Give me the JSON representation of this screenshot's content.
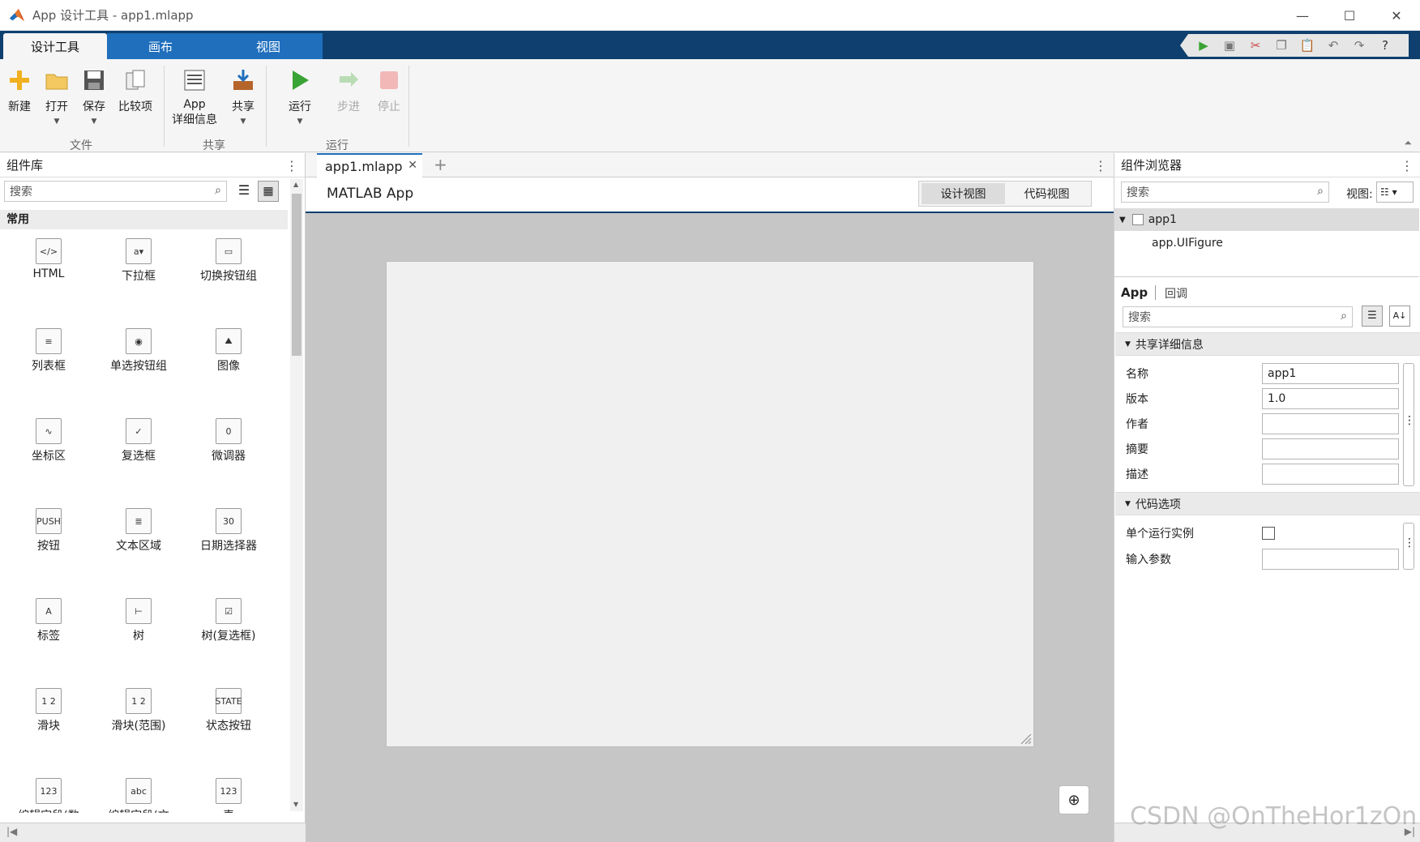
{
  "window": {
    "title": "App 设计工具 - app1.mlapp",
    "minimize": "—",
    "maximize": "☐",
    "close": "✕"
  },
  "tabs": [
    "设计工具",
    "画布",
    "视图"
  ],
  "quick_access": [
    "run-icon",
    "save-icon",
    "cut-icon",
    "copy-icon",
    "paste-icon",
    "undo-icon",
    "redo-icon",
    "help-icon"
  ],
  "toolstrip": {
    "file": {
      "label": "文件",
      "new": "新建",
      "open": "打开",
      "save": "保存",
      "compare": "比较项"
    },
    "share": {
      "label": "共享",
      "app_details_line1": "App",
      "app_details_line2": "详细信息",
      "share": "共享"
    },
    "run": {
      "label": "运行",
      "run": "运行",
      "step": "步进",
      "stop": "停止"
    }
  },
  "component_library": {
    "title": "组件库",
    "search_placeholder": "搜索",
    "section": "常用",
    "items": [
      {
        "label": "HTML",
        "icon": "html-icon",
        "glyph": "</>"
      },
      {
        "label": "下拉框",
        "icon": "dropdown-icon",
        "glyph": "a▾"
      },
      {
        "label": "切换按钮组",
        "icon": "toggle-button-group-icon",
        "glyph": "▭"
      },
      {
        "label": "列表框",
        "icon": "listbox-icon",
        "glyph": "≡"
      },
      {
        "label": "单选按钮组",
        "icon": "radio-button-group-icon",
        "glyph": "◉"
      },
      {
        "label": "图像",
        "icon": "image-icon",
        "glyph": "⛰"
      },
      {
        "label": "坐标区",
        "icon": "axes-icon",
        "glyph": "∿"
      },
      {
        "label": "复选框",
        "icon": "checkbox-icon",
        "glyph": "✓"
      },
      {
        "label": "微调器",
        "icon": "spinner-icon",
        "glyph": "0"
      },
      {
        "label": "按钮",
        "icon": "push-button-icon",
        "glyph": "PUSH"
      },
      {
        "label": "文本区域",
        "icon": "text-area-icon",
        "glyph": "≣"
      },
      {
        "label": "日期选择器",
        "icon": "date-picker-icon",
        "glyph": "30"
      },
      {
        "label": "标签",
        "icon": "label-icon",
        "glyph": "A"
      },
      {
        "label": "树",
        "icon": "tree-icon",
        "glyph": "⊢"
      },
      {
        "label": "树(复选框)",
        "icon": "checkbox-tree-icon",
        "glyph": "☑"
      },
      {
        "label": "滑块",
        "icon": "slider-icon",
        "glyph": "1 2"
      },
      {
        "label": "滑块(范围)",
        "icon": "range-slider-icon",
        "glyph": "1 2"
      },
      {
        "label": "状态按钮",
        "icon": "state-button-icon",
        "glyph": "STATE"
      },
      {
        "label": "编辑字段(数",
        "icon": "numeric-field-icon",
        "glyph": "123"
      },
      {
        "label": "编辑字段(文",
        "icon": "text-field-icon",
        "glyph": "abc"
      },
      {
        "label": "表",
        "icon": "table-icon",
        "glyph": "123"
      }
    ]
  },
  "editor": {
    "file_tab": "app1.mlapp",
    "app_name": "MATLAB App",
    "design_view": "设计视图",
    "code_view": "代码视图"
  },
  "component_browser": {
    "title": "组件浏览器",
    "search_placeholder": "搜索",
    "view_label": "视图:",
    "tree_root": "app1",
    "tree_child": "app.UIFigure",
    "tab_app": "App",
    "tab_callback": "回调",
    "prop_search_placeholder": "搜索",
    "section_shared": "共享详细信息",
    "section_code": "代码选项",
    "props": {
      "name_label": "名称",
      "name_value": "app1",
      "version_label": "版本",
      "version_value": "1.0",
      "author_label": "作者",
      "author_value": "",
      "summary_label": "摘要",
      "summary_value": "",
      "description_label": "描述",
      "description_value": "",
      "single_instance_label": "单个运行实例",
      "input_args_label": "输入参数",
      "input_args_value": ""
    }
  },
  "watermark": "CSDN @OnTheHor1zOn"
}
